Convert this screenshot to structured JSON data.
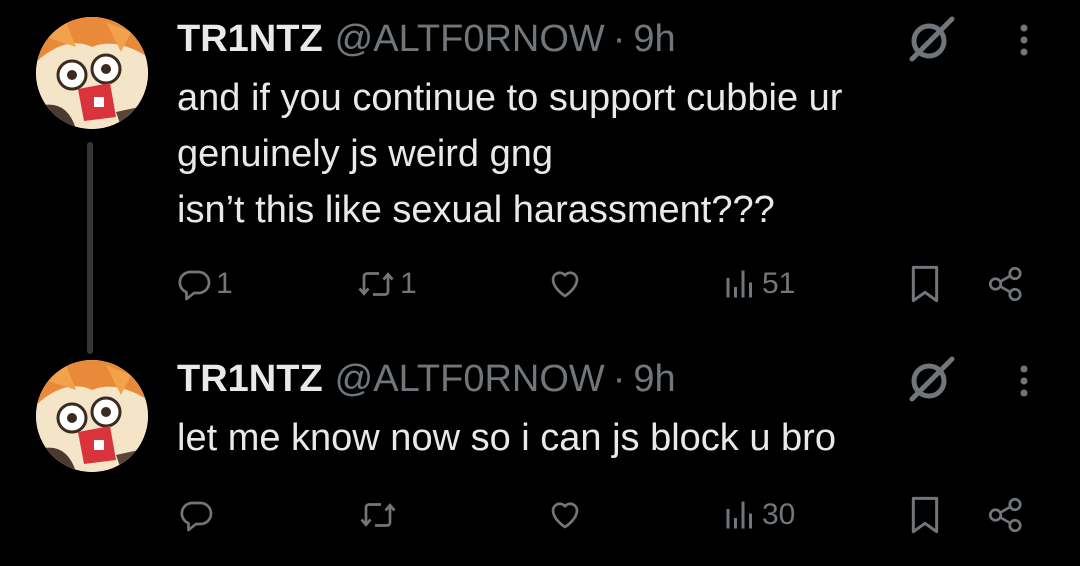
{
  "tweets": [
    {
      "name": "TR1NTZ",
      "handle": "@ALTF0RNOW",
      "separator": "·",
      "time": "9h",
      "lines": [
        "and if you continue to support cubbie ur",
        "genuinely js weird gng",
        "isn’t this like sexual harassment???"
      ],
      "replies": "1",
      "reposts": "1",
      "likes": "",
      "views": "51"
    },
    {
      "name": "TR1NTZ",
      "handle": "@ALTF0RNOW",
      "separator": "·",
      "time": "9h",
      "lines": [
        "let me know now so i can js block u bro"
      ],
      "replies": "",
      "reposts": "",
      "likes": "",
      "views": "30"
    }
  ],
  "colors": {
    "background": "#000000",
    "text": "#e7e9ea",
    "muted": "#71767b",
    "thread_line": "#333639"
  },
  "icons": [
    "avatar",
    "grok-icon",
    "more-icon",
    "reply-icon",
    "repost-icon",
    "like-icon",
    "views-icon",
    "bookmark-icon",
    "share-icon"
  ]
}
